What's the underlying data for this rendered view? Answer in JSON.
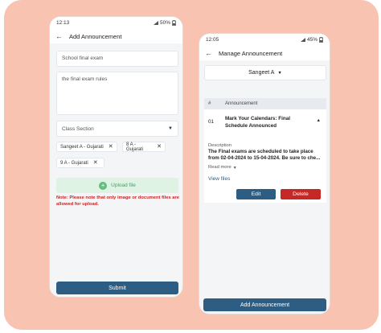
{
  "left_phone": {
    "status": {
      "time": "12:13",
      "battery": "50%"
    },
    "app_bar": {
      "title": "Add Announcement"
    },
    "form": {
      "title_value": "School final exam",
      "description_value": "the final exam rules",
      "class_section_placeholder": "Class Section",
      "chips": [
        {
          "label": "Sangeet A - Gujarati"
        },
        {
          "label": "8 A - Gujarati"
        },
        {
          "label": "9 A - Gujarati"
        }
      ],
      "upload_label": "Upload file",
      "note": "Note: Please note that only image or document files are allowed for upload.",
      "submit_label": "Submit"
    }
  },
  "right_phone": {
    "status": {
      "time": "12:05",
      "battery": "45%"
    },
    "app_bar": {
      "title": "Manage Announcement"
    },
    "selector": {
      "value": "Sangeet A"
    },
    "table": {
      "headers": {
        "index": "#",
        "announcement": "Announcement"
      },
      "row": {
        "index": "01",
        "title": "Mark Your Calendars: Final Schedule Announced",
        "description_label": "Description",
        "description": "The Final exams are scheduled to take place from 02-04-2024 to 15-04-2024. Be sure to che...",
        "read_more": "Read more",
        "view_files": "View files",
        "edit_label": "Edit",
        "delete_label": "Delete"
      }
    },
    "add_button_label": "Add Announcement"
  },
  "colors": {
    "background": "#f8c3b0",
    "primary": "#2d5d82",
    "danger": "#c62828",
    "upload_bg": "#dff3e4",
    "upload_text": "#3fa35c"
  },
  "icons": {
    "back": "arrow-left-icon",
    "dropdown": "caret-down-icon",
    "remove": "close-icon",
    "upload": "plus-circle-icon",
    "collapse": "caret-up-icon"
  }
}
